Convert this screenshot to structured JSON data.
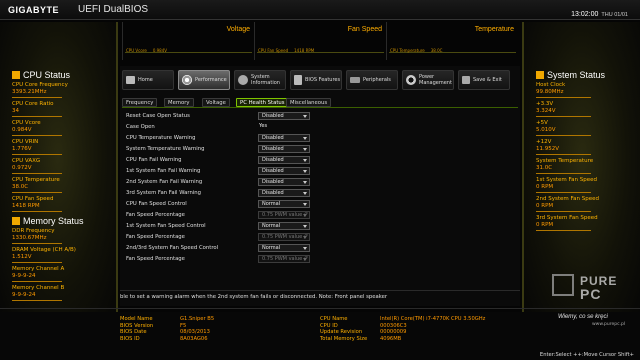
{
  "title": {
    "logo": "GIGABYTE",
    "bios_name": "UEFI DualBIOS",
    "time": "13:02:00",
    "date": "THU 01/01"
  },
  "graphs": [
    {
      "title": "Voltage",
      "caption": [
        "CPU Vcore",
        "0.984V"
      ]
    },
    {
      "title": "Fan Speed",
      "caption": [
        "CPU Fan Speed",
        "1418 RPM"
      ]
    },
    {
      "title": "Temperature",
      "caption": [
        "CPU Temperature",
        "38.0C"
      ]
    }
  ],
  "cpu_status": {
    "title": "CPU Status",
    "items": [
      {
        "label": "CPU Core Frequency",
        "value": "3393.21MHz"
      },
      {
        "label": "CPU Core Ratio",
        "value": "34"
      },
      {
        "label": "CPU Vcore",
        "value": "0.984V"
      },
      {
        "label": "CPU VRIN",
        "value": "1.776V"
      },
      {
        "label": "CPU VAXG",
        "value": "0.972V"
      },
      {
        "label": "CPU Temperature",
        "value": "38.0C"
      },
      {
        "label": "CPU Fan Speed",
        "value": "1418 RPM"
      }
    ]
  },
  "memory_status": {
    "title": "Memory Status",
    "items": [
      {
        "label": "DDR Frequency",
        "value": "1330.67MHz"
      },
      {
        "label": "DRAM Voltage   (CH A/B)",
        "value": "1.512V"
      },
      {
        "label": "Memory Channel A",
        "value": "9-9-9-24"
      },
      {
        "label": "Memory Channel B",
        "value": "9-9-9-24"
      }
    ]
  },
  "system_status": {
    "title": "System Status",
    "items": [
      {
        "label": "Host Clock",
        "value": "99.80MHz"
      },
      {
        "label": "+3.3V",
        "value": "3.324V"
      },
      {
        "label": "+5V",
        "value": "5.010V"
      },
      {
        "label": "+12V",
        "value": "11.952V"
      },
      {
        "label": "System Temperature",
        "value": "31.0C"
      },
      {
        "label": "1st System Fan Speed",
        "value": "0 RPM"
      },
      {
        "label": "2nd System Fan Speed",
        "value": "0 RPM"
      },
      {
        "label": "3rd System Fan Speed",
        "value": "0 RPM"
      }
    ]
  },
  "nav": [
    {
      "label": "Home",
      "icon": "home-icon"
    },
    {
      "label": "Performance",
      "icon": "performance-icon"
    },
    {
      "label": "System Information",
      "icon": "system-info-icon"
    },
    {
      "label": "BIOS Features",
      "icon": "bios-features-icon"
    },
    {
      "label": "Peripherals",
      "icon": "peripherals-icon"
    },
    {
      "label": "Power Management",
      "icon": "power-icon"
    },
    {
      "label": "Save & Exit",
      "icon": "save-exit-icon"
    }
  ],
  "tabs": [
    "Frequency",
    "Memory",
    "Voltage",
    "PC Health Status",
    "Miscellaneous"
  ],
  "rows": [
    {
      "label": "Reset Case Open Status",
      "value": "Disabled",
      "type": "select"
    },
    {
      "label": "Case Open",
      "value": "Yes",
      "type": "text"
    },
    {
      "label": "CPU Temperature Warning",
      "value": "Disabled",
      "type": "select"
    },
    {
      "label": "System Temperature Warning",
      "value": "Disabled",
      "type": "select"
    },
    {
      "label": "CPU Fan Fail Warning",
      "value": "Disabled",
      "type": "select"
    },
    {
      "label": "1st System Fan Fail Warning",
      "value": "Disabled",
      "type": "select"
    },
    {
      "label": "2nd System Fan Fail Warning",
      "value": "Disabled",
      "type": "select"
    },
    {
      "label": "3rd System Fan Fail Warning",
      "value": "Disabled",
      "type": "select"
    },
    {
      "label": "CPU Fan Speed Control",
      "value": "Normal",
      "type": "select"
    },
    {
      "label": "Fan Speed Percentage",
      "value": "0.75 PWM value /°",
      "type": "disabled"
    },
    {
      "label": "1st System Fan Speed Control",
      "value": "Normal",
      "type": "select"
    },
    {
      "label": "Fan Speed Percentage",
      "value": "0.75 PWM value /°",
      "type": "disabled"
    },
    {
      "label": "2nd/3rd System Fan Speed Control",
      "value": "Normal",
      "type": "select"
    },
    {
      "label": "Fan Speed Percentage",
      "value": "0.75 PWM value /°",
      "type": "disabled"
    }
  ],
  "help_text": "ble to set a warning alarm when the 2nd system fan fails or disconnected. Note: Front panel speaker",
  "info_left": [
    {
      "k": "Model Name",
      "v": "G1.Sniper B5"
    },
    {
      "k": "BIOS Version",
      "v": "F5"
    },
    {
      "k": "BIOS Date",
      "v": "08/03/2013"
    },
    {
      "k": "BIOS ID",
      "v": "8A03AG06"
    }
  ],
  "info_right": [
    {
      "k": "CPU Name",
      "v": "Intel(R) Core(TM) i7-4770K CPU  3.50GHz"
    },
    {
      "k": "CPU ID",
      "v": "000306C3"
    },
    {
      "k": "Update Revision",
      "v": "00000009"
    },
    {
      "k": "Total Memory Size",
      "v": "4096MB"
    }
  ],
  "keys": "Enter:Select  ++:Move Cursor  Shift+",
  "watermark": {
    "line1": "PURE",
    "line2": "PC",
    "tagline": "Wiemy, co se kręci",
    "url": "www.purepc.pl"
  }
}
